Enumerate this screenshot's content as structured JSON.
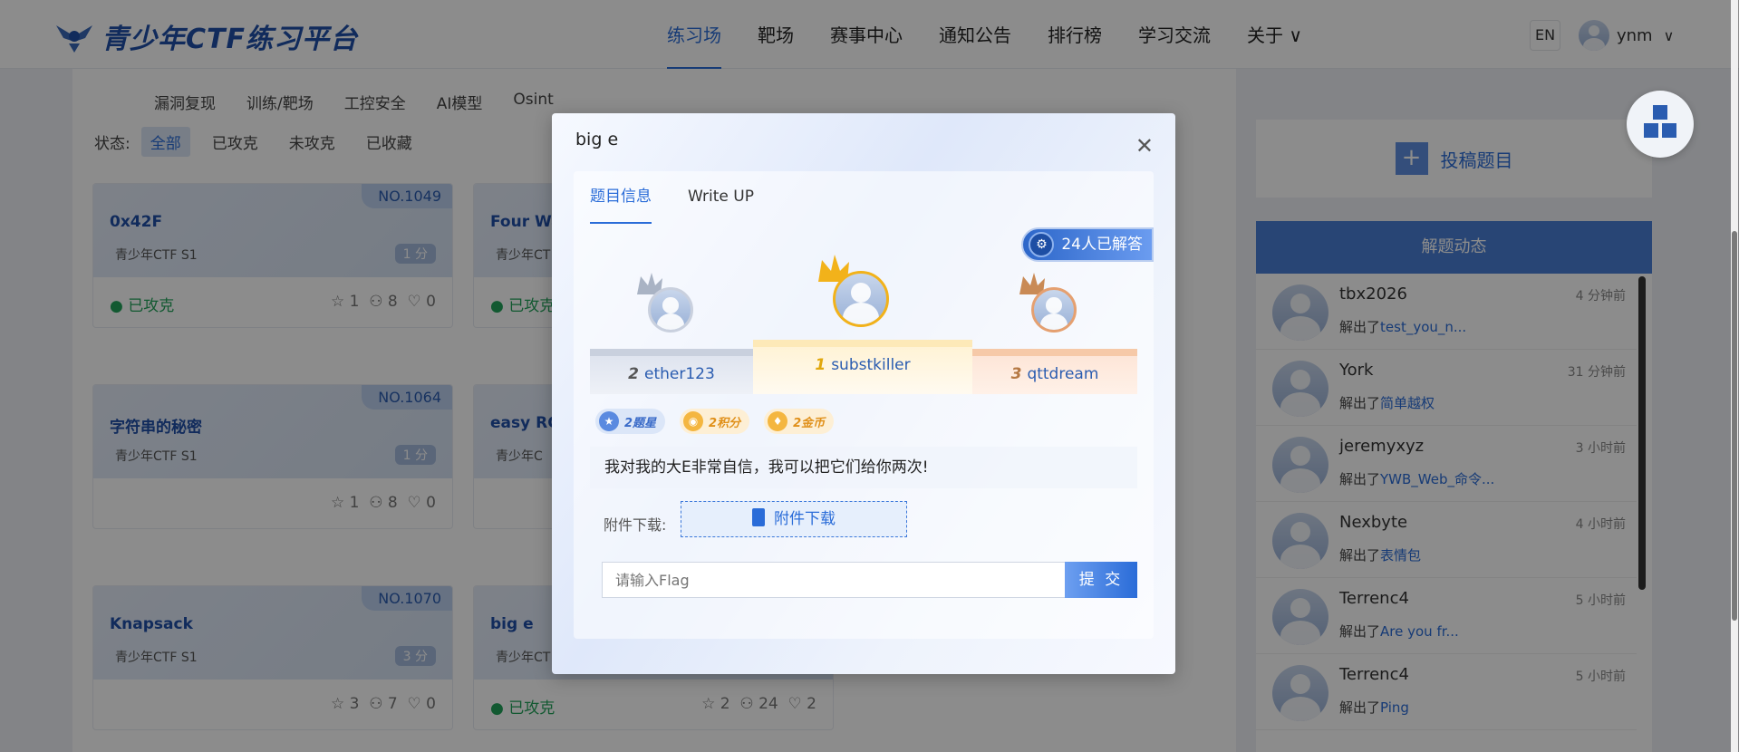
{
  "header": {
    "logo_text": "青少年CTF练习平台",
    "nav": [
      "练习场",
      "靶场",
      "赛事中心",
      "通知公告",
      "排行榜",
      "学习交流",
      "关于"
    ],
    "lang": "EN",
    "username": "ynm"
  },
  "filters": {
    "categories": [
      "漏洞复现",
      "训练/靶场",
      "工控安全",
      "AI模型",
      "Osint"
    ],
    "status_label": "状态:",
    "status_options": [
      "全部",
      "已攻克",
      "未攻克",
      "已收藏"
    ]
  },
  "cards": [
    {
      "no": "NO.1049",
      "title": "0x42F",
      "sub": "青少年CTF S1",
      "pts": "1 分",
      "solved": "已攻克",
      "stars": "1",
      "users": "8",
      "likes": "0"
    },
    {
      "no": "",
      "title": "Four Wa",
      "sub": "青少年CT",
      "pts": "",
      "solved": "已攻克",
      "stars": "",
      "users": "",
      "likes": ""
    },
    {
      "no": "NO.1064",
      "title": "字符串的秘密",
      "sub": "青少年CTF S1",
      "pts": "1 分",
      "solved": "",
      "stars": "1",
      "users": "8",
      "likes": "0"
    },
    {
      "no": "",
      "title": "easy RC",
      "sub": "青少年C",
      "pts": "",
      "solved": "",
      "stars": "",
      "users": "",
      "likes": ""
    },
    {
      "no": "NO.1070",
      "title": "Knapsack",
      "sub": "青少年CTF S1",
      "pts": "3 分",
      "solved": "",
      "stars": "3",
      "users": "7",
      "likes": "0"
    },
    {
      "no": "",
      "title": "big e",
      "sub": "青少年CT",
      "pts": "",
      "solved": "已攻克",
      "stars": "2",
      "users": "24",
      "likes": "2"
    }
  ],
  "side": {
    "post_label": "投稿题目",
    "feed_title": "解题动态",
    "solved_prefix": "解出了",
    "feed": [
      {
        "name": "tbx2026",
        "time": "4 分钟前",
        "task": "test_you_n..."
      },
      {
        "name": "York",
        "time": "31 分钟前",
        "task": "简单越权"
      },
      {
        "name": "jeremyxyz",
        "time": "3 小时前",
        "task": "YWB_Web_命令..."
      },
      {
        "name": "Nexbyte",
        "time": "4 小时前",
        "task": "表情包"
      },
      {
        "name": "Terrenc4",
        "time": "5 小时前",
        "task": "Are you fr..."
      },
      {
        "name": "Terrenc4",
        "time": "5 小时前",
        "task": "Ping"
      }
    ]
  },
  "modal": {
    "title": "big e",
    "tabs": [
      "题目信息",
      "Write UP"
    ],
    "solved_count": "24人已解答",
    "podium": [
      {
        "rank": "2",
        "name": "ether123"
      },
      {
        "rank": "1",
        "name": "substkiller"
      },
      {
        "rank": "3",
        "name": "qttdream"
      }
    ],
    "rewards": [
      "2题星",
      "2积分",
      "2金币"
    ],
    "description": "我对我的大E非常自信，我可以把它们给你两次!",
    "attach_label": "附件下载:",
    "attach_button": "附件下载",
    "flag_placeholder": "请输入Flag",
    "submit": "提 交"
  },
  "colors": {
    "accent": "#2a6cd8",
    "brand": "#1f4fa8",
    "solved": "#22a35a"
  }
}
